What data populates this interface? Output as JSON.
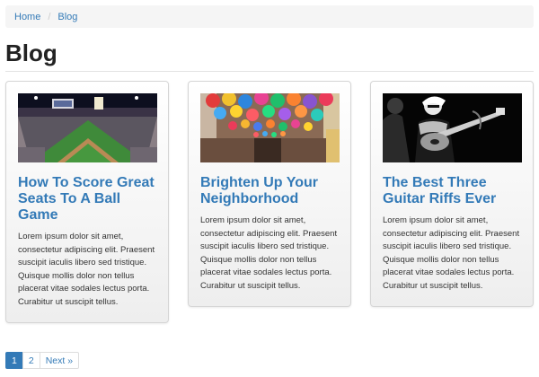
{
  "breadcrumb": {
    "items": [
      {
        "label": "Home"
      },
      {
        "label": "Blog"
      }
    ],
    "separator": "/"
  },
  "page": {
    "title": "Blog"
  },
  "posts": [
    {
      "title": "How To Score Great Seats To A Ball Game",
      "excerpt": "Lorem ipsum dolor sit amet, consectetur adipiscing elit. Praesent suscipit iaculis libero sed tristique. Quisque mollis dolor non tellus placerat vitae sodales lectus porta. Curabitur ut suscipit tellus.",
      "image": "baseball-stadium-image"
    },
    {
      "title": "Brighten Up Your Neighborhood",
      "excerpt": "Lorem ipsum dolor sit amet, consectetur adipiscing elit. Praesent suscipit iaculis libero sed tristique. Quisque mollis dolor non tellus placerat vitae sodales lectus porta. Curabitur ut suscipit tellus.",
      "image": "umbrella-street-image"
    },
    {
      "title": "The Best Three Guitar Riffs Ever",
      "excerpt": "Lorem ipsum dolor sit amet, consectetur adipiscing elit. Praesent suscipit iaculis libero sed tristique. Quisque mollis dolor non tellus placerat vitae sodales lectus porta. Curabitur ut suscipit tellus.",
      "image": "guitarist-concert-image"
    }
  ],
  "pagination": {
    "pages": [
      "1",
      "2"
    ],
    "current": "1",
    "next_label": "Next »"
  },
  "colors": {
    "link": "#337ab7",
    "breadcrumb_bg": "#f5f5f5",
    "title": "#222222"
  }
}
